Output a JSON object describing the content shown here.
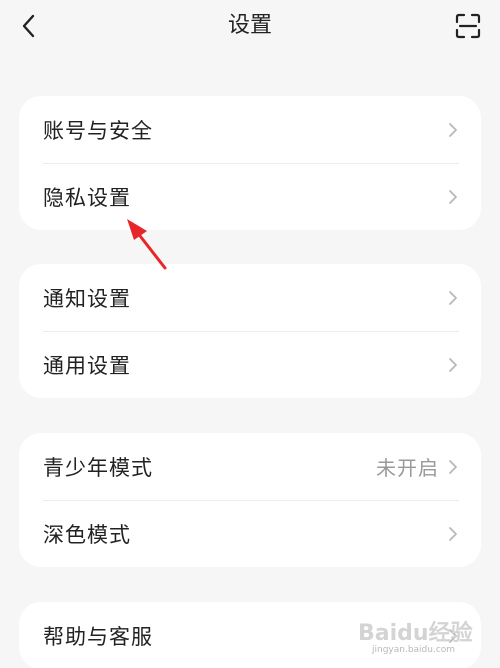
{
  "header": {
    "title": "设置",
    "back_icon": "chevron-left-icon",
    "scan_icon": "scan-icon"
  },
  "groups": [
    {
      "items": [
        {
          "label": "账号与安全"
        },
        {
          "label": "隐私设置"
        }
      ]
    },
    {
      "items": [
        {
          "label": "通知设置"
        },
        {
          "label": "通用设置"
        }
      ]
    },
    {
      "items": [
        {
          "label": "青少年模式",
          "value": "未开启"
        },
        {
          "label": "深色模式"
        }
      ]
    },
    {
      "items": [
        {
          "label": "帮助与客服"
        }
      ]
    }
  ],
  "watermark": {
    "brand": "Baidu经验",
    "url": "jingyan.baidu.com"
  },
  "colors": {
    "background": "#f6f6f6",
    "card": "#ffffff",
    "annotation_arrow": "#e8262a",
    "chevron": "#b8b8b8"
  }
}
